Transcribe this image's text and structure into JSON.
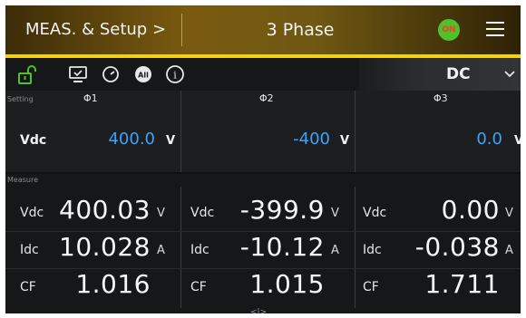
{
  "header": {
    "meas_title": "MEAS. & Setup >",
    "mode_title": "3 Phase",
    "output_badge": "ON",
    "colors": {
      "accent": "#f0d21a",
      "on_badge": "#4fc22a",
      "on_text": "#ff3a2a",
      "value_blue": "#3aa3ff"
    }
  },
  "toolbar": {
    "icons": [
      "unlock-icon",
      "monitor-icon",
      "timer-icon",
      "all-icon",
      "info-icon"
    ],
    "all_label": "All",
    "info_label": "i",
    "mode_select": "DC"
  },
  "setting": {
    "section_label": "Setting",
    "phases": [
      "Φ1",
      "Φ2",
      "Φ3"
    ],
    "quantity": "Vdc",
    "values": [
      "400.0",
      "-400",
      "0.0"
    ],
    "unit": "V"
  },
  "measure": {
    "section_label": "Measure",
    "rows": [
      {
        "label": "Vdc",
        "unit": "V",
        "values": [
          "400.03",
          "-399.9",
          "0.00"
        ]
      },
      {
        "label": "Idc",
        "unit": "A",
        "values": [
          "10.028",
          "-10.12",
          "-0.038"
        ]
      },
      {
        "label": "CF",
        "unit": "",
        "values": [
          "1.016",
          "1.015",
          "1.711"
        ]
      }
    ]
  },
  "footer": {
    "handle": "<|>"
  }
}
